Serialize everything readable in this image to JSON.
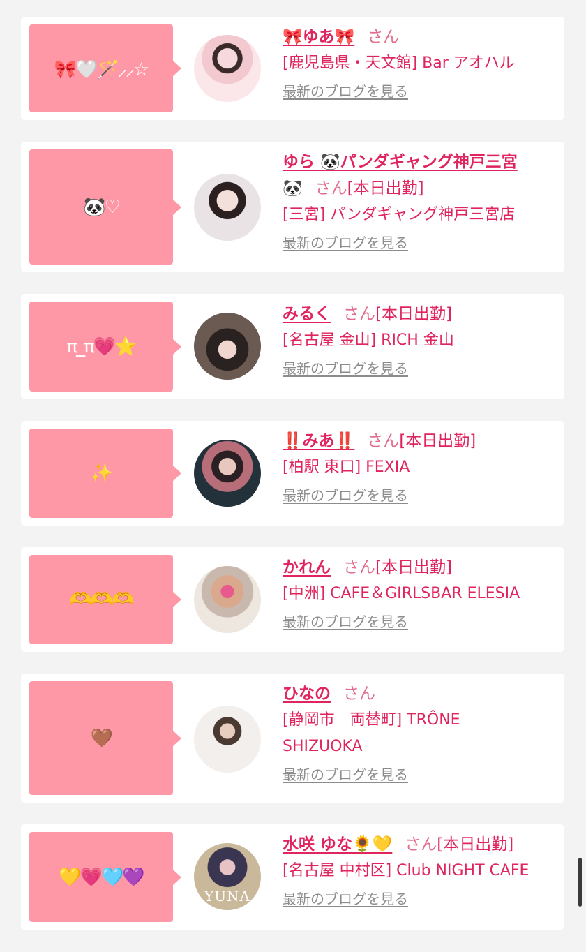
{
  "cards": [
    {
      "comment": "🎀🤍🪄⸝⸝☆",
      "name": "🎀ゆあ🎀",
      "san": "さん",
      "status": "",
      "shop": "[鹿児島県・天文館] Bar アオハル",
      "blog": "最新のブログを見る"
    },
    {
      "comment": "🐼♡",
      "name": "ゆら 🐼パンダギャング神戸三宮",
      "name_tail": "🐼",
      "san": "さん",
      "status": "[本日出勤]",
      "shop": "[三宮] パンダギャング神戸三宮店",
      "blog": "最新のブログを見る"
    },
    {
      "comment": "π_π💗⭐",
      "name": "みるく",
      "san": "さん",
      "status": "[本日出勤]",
      "shop": "[名古屋 金山] RICH 金山",
      "blog": "最新のブログを見る"
    },
    {
      "comment": "✨",
      "name": "‼️みあ‼️",
      "san": "さん",
      "status": "[本日出勤]",
      "shop": "[柏駅 東口] FEXIA",
      "blog": "最新のブログを見る"
    },
    {
      "comment": "🫶🫶🫶",
      "name": "かれん",
      "san": "さん",
      "status": "[本日出勤]",
      "shop": "[中洲] CAFE＆GIRLSBAR ELESIA",
      "blog": "最新のブログを見る"
    },
    {
      "comment": "🤎",
      "name": "ひなの",
      "san": "さん",
      "status": "",
      "shop": "[静岡市　両替町] TRÔNE SHIZUOKA",
      "blog": "最新のブログを見る"
    },
    {
      "comment": "💛💗🩵💜",
      "name": "水咲 ゆな🌻💛",
      "san": "さん",
      "status": "[本日出勤]",
      "shop": "[名古屋 中村区] Club NIGHT CAFE",
      "blog": "最新のブログを見る",
      "avatar_text": "YUNA"
    }
  ],
  "colors": {
    "bubble": "#ff98a6",
    "name": "#e0245e",
    "shop": "#e0245e",
    "link_gray": "#8c8c8c",
    "page_bg": "#f3f3f3"
  }
}
